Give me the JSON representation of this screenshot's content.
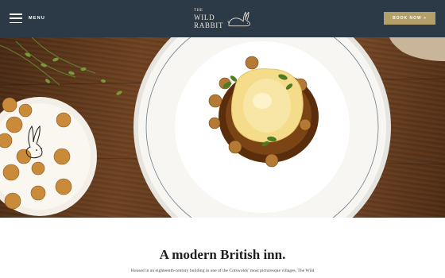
{
  "header": {
    "menu_label": "MENU",
    "logo": {
      "the": "THE",
      "line1": "WILD",
      "line2": "RABBIT",
      "icon": "rabbit-icon"
    },
    "book_label": "BOOK NOW »"
  },
  "hero": {
    "slide_count": 7,
    "active_slide": 1
  },
  "content": {
    "headline": "A modern British inn.",
    "intro": "Housed in an eighteenth-century building in one of the Cotswolds’ most picturesque villages, The Wild"
  },
  "colors": {
    "header_bg": "#2c3947",
    "accent": "#b39f68",
    "logo_text": "#e9e4d6"
  }
}
